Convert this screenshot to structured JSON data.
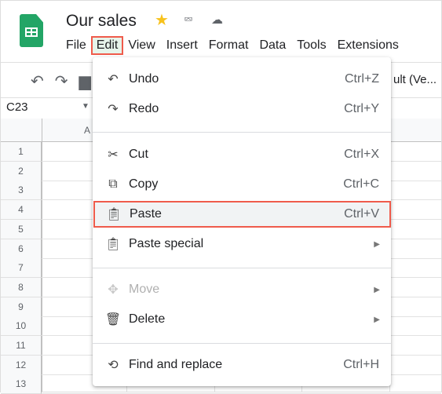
{
  "app": {
    "title": "Our sales",
    "icons": [
      "star-icon",
      "move-to-folder-icon",
      "cloud-saved-icon"
    ]
  },
  "menubar": [
    "File",
    "Edit",
    "View",
    "Insert",
    "Format",
    "Data",
    "Tools",
    "Extensions"
  ],
  "toolbar": {
    "font": "ult (Ve..."
  },
  "namebox": "C23",
  "grid": {
    "column_visible": "A",
    "rows": [
      "1",
      "2",
      "3",
      "4",
      "5",
      "6",
      "7",
      "8",
      "9",
      "10",
      "11",
      "12",
      "13"
    ]
  },
  "edit_menu": {
    "items": [
      {
        "label": "Undo",
        "shortcut": "Ctrl+Z",
        "icon": "undo-icon"
      },
      {
        "label": "Redo",
        "shortcut": "Ctrl+Y",
        "icon": "redo-icon"
      },
      {
        "label": "Cut",
        "shortcut": "Ctrl+X",
        "icon": "scissors-icon"
      },
      {
        "label": "Copy",
        "shortcut": "Ctrl+C",
        "icon": "copy-icon"
      },
      {
        "label": "Paste",
        "shortcut": "Ctrl+V",
        "icon": "clipboard-icon",
        "highlighted": true
      },
      {
        "label": "Paste special",
        "submenu": true,
        "icon": "clipboard-icon"
      },
      {
        "label": "Move",
        "submenu": true,
        "disabled": true,
        "icon": "move-icon"
      },
      {
        "label": "Delete",
        "submenu": true,
        "icon": "trash-icon"
      },
      {
        "label": "Find and replace",
        "shortcut": "Ctrl+H",
        "icon": "find-replace-icon"
      }
    ]
  },
  "colors": {
    "highlight_outline": "#ef5b4b",
    "sheets_green": "#23a566"
  }
}
